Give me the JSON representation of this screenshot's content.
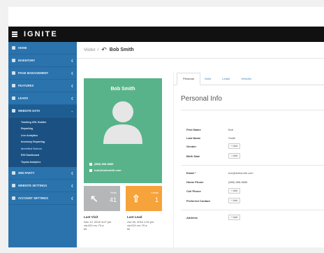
{
  "app": {
    "logo": "IGNITE"
  },
  "sidebar": {
    "items": [
      {
        "label": "HOME",
        "has_children": false
      },
      {
        "label": "INVENTORY",
        "has_children": true
      },
      {
        "label": "PAGE MANAGEMENT",
        "has_children": true
      },
      {
        "label": "FEATURES",
        "has_children": true
      },
      {
        "label": "LEADS",
        "has_children": true
      },
      {
        "label": "WEBSITE DATA",
        "has_children": true,
        "active": true
      }
    ],
    "subitems": [
      "Tracking URL Builder",
      "Reporting",
      "Live Analytics",
      "Inventory Reporting",
      "Identified Visitors",
      "ROI Dashboard",
      "Toyota Analytics"
    ],
    "bottom_items": [
      {
        "label": "3RD PARTY",
        "has_children": true
      },
      {
        "label": "WEBSITE SETTINGS",
        "has_children": true
      },
      {
        "label": "ACCOUNT SETTINGS",
        "has_children": true
      }
    ]
  },
  "breadcrumb": {
    "parent": "Visitor",
    "separator": "/",
    "current": "Bob Smith"
  },
  "profile": {
    "name": "Bob Smith",
    "phone": "(888) 888-8888",
    "email": "bob@bobsmith.com",
    "card_color": "#58b38a"
  },
  "stats": {
    "visits": {
      "label": "Visits",
      "value": "41",
      "color": "#b4b6b8"
    },
    "leads": {
      "label": "Leads",
      "value": "1",
      "color": "#f5a33a"
    }
  },
  "last_visit": {
    "title": "Last Visit",
    "line1": "Dec 12, 2016 3:07 pm",
    "line2": "via IDX rev 70.a",
    "line3": "tel"
  },
  "last_lead": {
    "title": "Last Lead",
    "line1": "Oct 28, 2016 1:02 pm",
    "line2": "via IDX rev 70.a",
    "line3": "tel"
  },
  "tabs": [
    "Personal",
    "Visits",
    "Leads",
    "Vehicles"
  ],
  "section": {
    "title": "Personal Info"
  },
  "fields": {
    "first_name": {
      "label": "First Name",
      "value": "Bob"
    },
    "last_name": {
      "label": "Last Name",
      "value": "Smith"
    },
    "gender": {
      "label": "Gender",
      "value": "+ Add"
    },
    "birth_date": {
      "label": "Birth Date",
      "value": "+ Add"
    },
    "email": {
      "label": "Email *",
      "value": "bob@bobsmith.com"
    },
    "home_phone": {
      "label": "Home Phone",
      "value": "(888) 888-8888"
    },
    "cell_phone": {
      "label": "Cell Phone",
      "value": "+ Add"
    },
    "preferred_contact": {
      "label": "Preferred Contact",
      "value": "+ Add"
    },
    "address": {
      "label": "Address",
      "value": "+ Add"
    }
  }
}
